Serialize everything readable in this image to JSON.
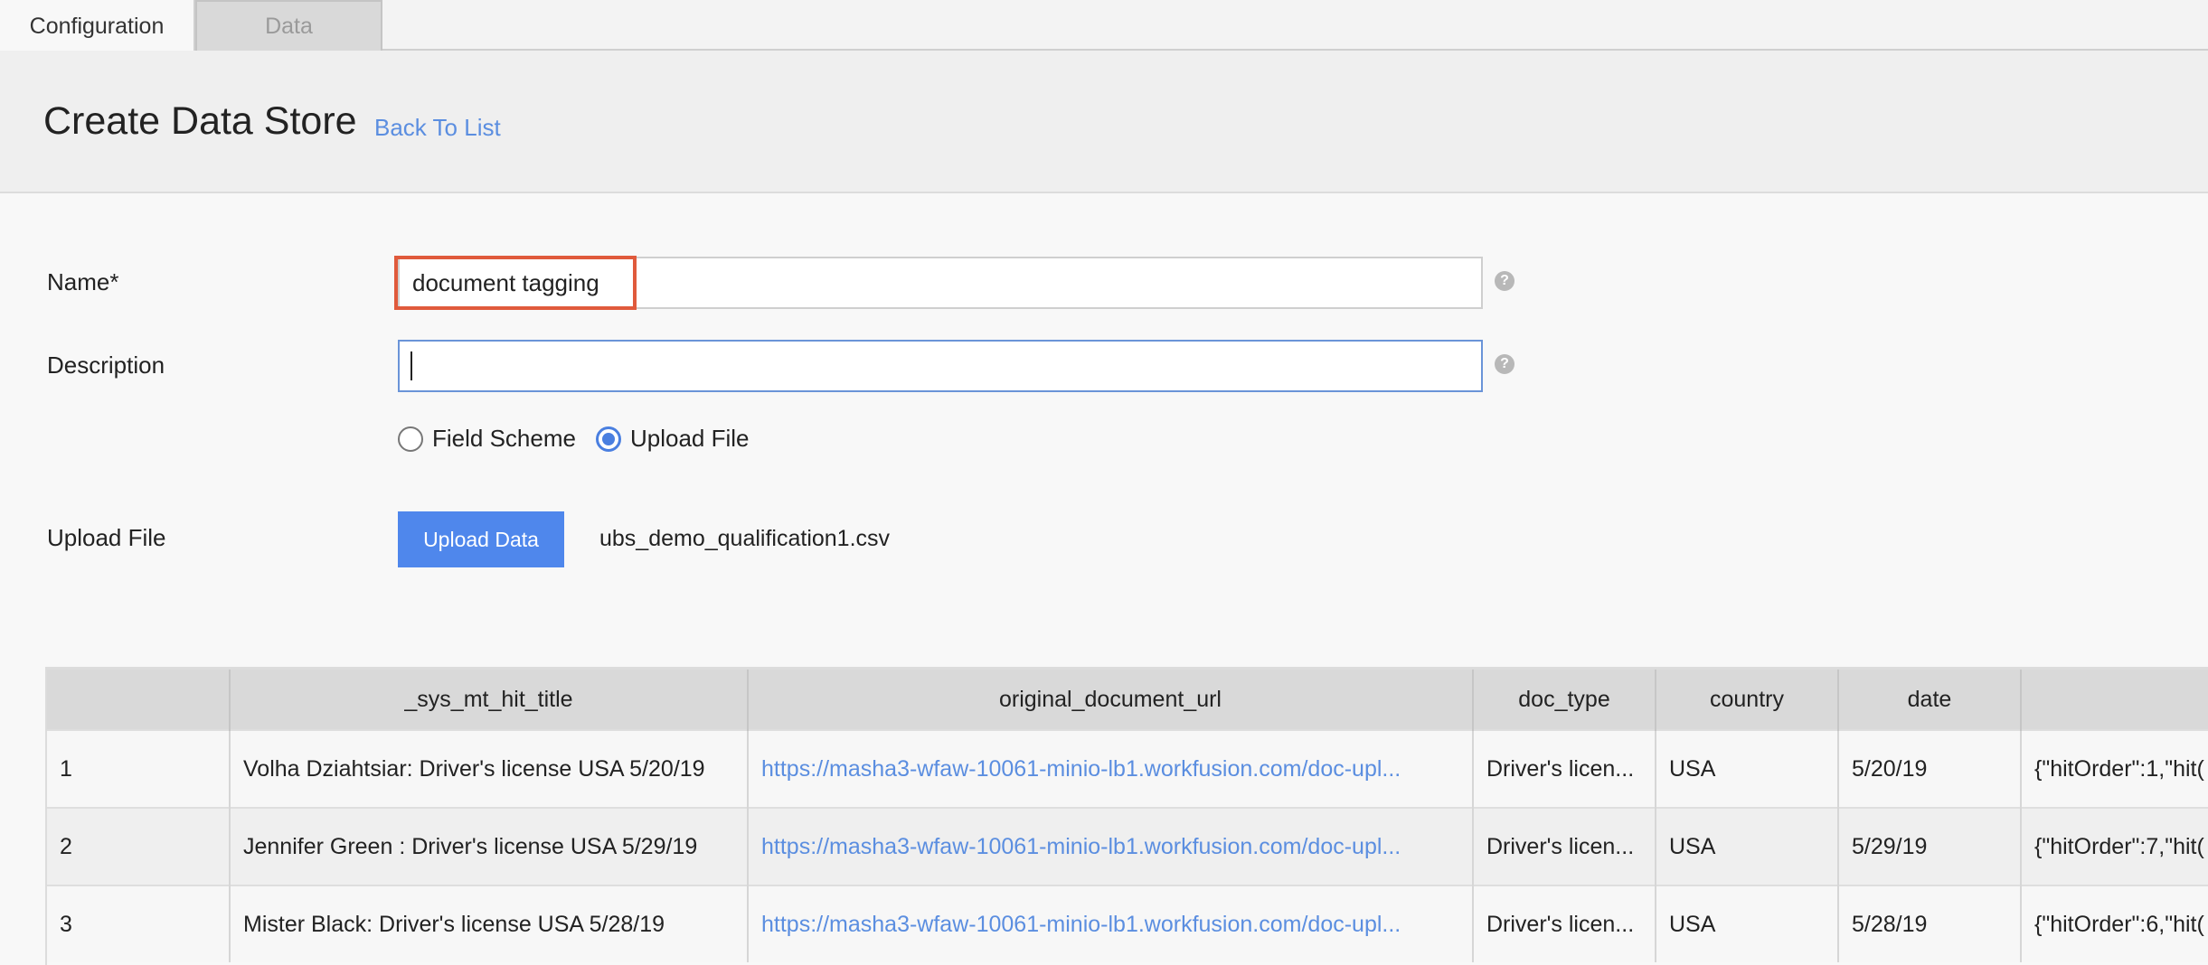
{
  "tabs": [
    {
      "label": "Configuration",
      "active": true
    },
    {
      "label": "Data",
      "active": false
    }
  ],
  "header": {
    "title": "Create Data Store",
    "back_link": "Back To List"
  },
  "form": {
    "name_label": "Name*",
    "name_value": "document tagging",
    "description_label": "Description",
    "description_value": "",
    "help_icon": "?",
    "radio_options": [
      {
        "label": "Field Scheme",
        "checked": false
      },
      {
        "label": "Upload File",
        "checked": true
      }
    ],
    "upload_label": "Upload File",
    "upload_button": "Upload Data",
    "uploaded_filename": "ubs_demo_qualification1.csv"
  },
  "table": {
    "columns": [
      "",
      "_sys_mt_hit_title",
      "original_document_url",
      "doc_type",
      "country",
      "date",
      ""
    ],
    "rows": [
      [
        "1",
        "Volha Dziahtsiar: Driver's license USA 5/20/19",
        "https://masha3-wfaw-10061-minio-lb1.workfusion.com/doc-upl...",
        "Driver's licen...",
        "USA",
        "5/20/19",
        "{\"hitOrder\":1,\"hit("
      ],
      [
        "2",
        "Jennifer Green : Driver's license USA 5/29/19",
        "https://masha3-wfaw-10061-minio-lb1.workfusion.com/doc-upl...",
        "Driver's licen...",
        "USA",
        "5/29/19",
        "{\"hitOrder\":7,\"hit("
      ],
      [
        "3",
        "Mister Black: Driver's license USA 5/28/19",
        "https://masha3-wfaw-10061-minio-lb1.workfusion.com/doc-upl...",
        "Driver's licen...",
        "USA",
        "5/28/19",
        "{\"hitOrder\":6,\"hit("
      ]
    ]
  },
  "colors": {
    "accent": "#4f87ec",
    "link": "#5b8ee0",
    "highlight": "#e05a3c"
  }
}
